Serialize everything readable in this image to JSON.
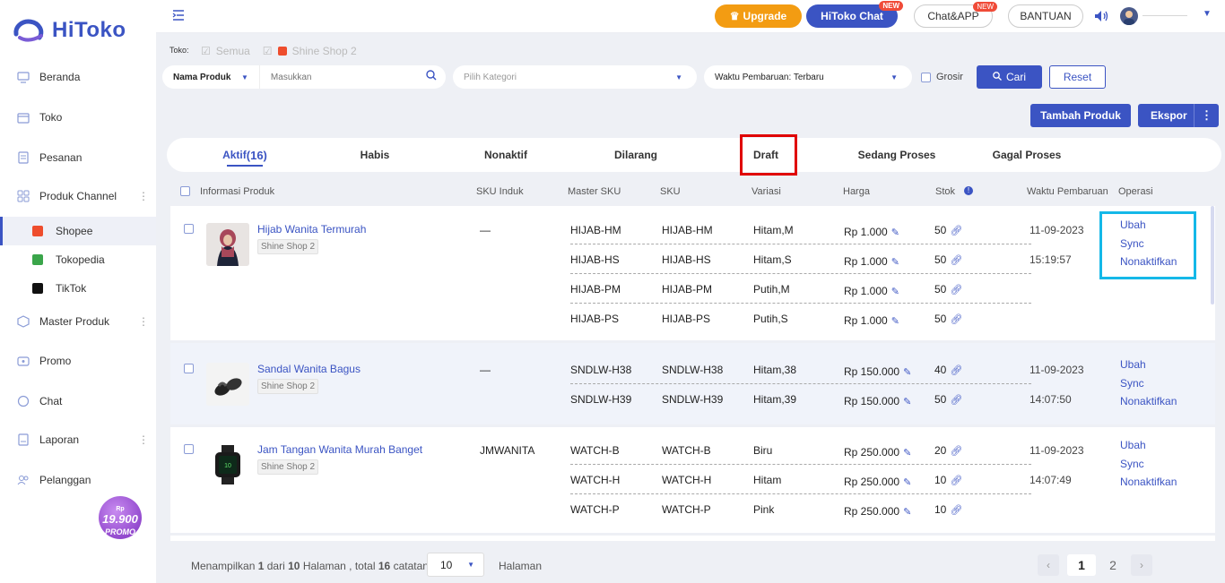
{
  "brand": {
    "name": "HiToko"
  },
  "sidebar": {
    "items": [
      {
        "label": "Beranda",
        "icon": "monitor-icon"
      },
      {
        "label": "Toko",
        "icon": "store-icon"
      },
      {
        "label": "Pesanan",
        "icon": "order-icon"
      },
      {
        "label": "Produk Channel",
        "icon": "grid-icon"
      },
      {
        "label": "Master Produk",
        "icon": "cube-icon"
      },
      {
        "label": "Promo",
        "icon": "promo-icon"
      },
      {
        "label": "Chat",
        "icon": "chat-icon"
      },
      {
        "label": "Laporan",
        "icon": "report-icon"
      },
      {
        "label": "Pelanggan",
        "icon": "users-icon"
      }
    ],
    "channels": [
      {
        "label": "Shopee",
        "color": "#ee4d2d"
      },
      {
        "label": "Tokopedia",
        "color": "#3aa54a"
      },
      {
        "label": "TikTok",
        "color": "#111111"
      }
    ],
    "promo": {
      "price": "19.900",
      "currency": "Rp",
      "label": "PROMO"
    }
  },
  "topbar": {
    "upgrade": "Upgrade",
    "hitoko_chat": "HiToko Chat",
    "chat_app": "Chat&APP",
    "new_badge": "NEW",
    "bantuan": "BANTUAN"
  },
  "filters": {
    "toko_label": "Toko:",
    "shop_all": "Semua",
    "shop_name": "Shine Shop 2",
    "field_select": "Nama Produk",
    "search_placeholder": "Masukkan",
    "category_placeholder": "Pilih Kategori",
    "sort_select": "Waktu Pembaruan: Terbaru",
    "grosir": "Grosir",
    "cari": "Cari",
    "reset": "Reset",
    "tambah": "Tambah Produk",
    "ekspor": "Ekspor"
  },
  "tabs": [
    {
      "label": "Aktif",
      "count": "(16)"
    },
    {
      "label": "Habis"
    },
    {
      "label": "Nonaktif"
    },
    {
      "label": "Dilarang"
    },
    {
      "label": "Draft"
    },
    {
      "label": "Sedang Proses"
    },
    {
      "label": "Gagal Proses"
    }
  ],
  "columns": {
    "info": "Informasi Produk",
    "sku_induk": "SKU Induk",
    "master_sku": "Master SKU",
    "sku": "SKU",
    "variasi": "Variasi",
    "harga": "Harga",
    "stok": "Stok",
    "waktu": "Waktu Pembaruan",
    "operasi": "Operasi"
  },
  "products": [
    {
      "name": "Hijab Wanita Termurah",
      "shop": "Shine Shop 2",
      "sku_induk": "—",
      "date": "11-09-2023",
      "time": "15:19:57",
      "variants": [
        {
          "master": "HIJAB-HM",
          "sku": "HIJAB-HM",
          "var": "Hitam,M",
          "price": "Rp 1.000",
          "stock": "50"
        },
        {
          "master": "HIJAB-HS",
          "sku": "HIJAB-HS",
          "var": "Hitam,S",
          "price": "Rp 1.000",
          "stock": "50"
        },
        {
          "master": "HIJAB-PM",
          "sku": "HIJAB-PM",
          "var": "Putih,M",
          "price": "Rp 1.000",
          "stock": "50"
        },
        {
          "master": "HIJAB-PS",
          "sku": "HIJAB-PS",
          "var": "Putih,S",
          "price": "Rp 1.000",
          "stock": "50"
        }
      ]
    },
    {
      "name": "Sandal Wanita Bagus",
      "shop": "Shine Shop 2",
      "sku_induk": "—",
      "date": "11-09-2023",
      "time": "14:07:50",
      "variants": [
        {
          "master": "SNDLW-H38",
          "sku": "SNDLW-H38",
          "var": "Hitam,38",
          "price": "Rp 150.000",
          "stock": "40"
        },
        {
          "master": "SNDLW-H39",
          "sku": "SNDLW-H39",
          "var": "Hitam,39",
          "price": "Rp 150.000",
          "stock": "50"
        }
      ]
    },
    {
      "name": "Jam Tangan Wanita Murah Banget",
      "shop": "Shine Shop 2",
      "sku_induk": "JMWANITA",
      "date": "11-09-2023",
      "time": "14:07:49",
      "variants": [
        {
          "master": "WATCH-B",
          "sku": "WATCH-B",
          "var": "Biru",
          "price": "Rp 250.000",
          "stock": "20"
        },
        {
          "master": "WATCH-H",
          "sku": "WATCH-H",
          "var": "Hitam",
          "price": "Rp 250.000",
          "stock": "10"
        },
        {
          "master": "WATCH-P",
          "sku": "WATCH-P",
          "var": "Pink",
          "price": "Rp 250.000",
          "stock": "10"
        }
      ]
    }
  ],
  "operations": {
    "ubah": "Ubah",
    "sync": "Sync",
    "nonaktifkan": "Nonaktifkan"
  },
  "pagination": {
    "text_a": "Menampilkan",
    "cur": "1",
    "text_b": "dari",
    "total_pages": "10",
    "text_c": "Halaman , total",
    "total": "16",
    "text_d": "catatan",
    "per_page": "10",
    "halaman": "Halaman",
    "pages": [
      "1",
      "2"
    ]
  }
}
